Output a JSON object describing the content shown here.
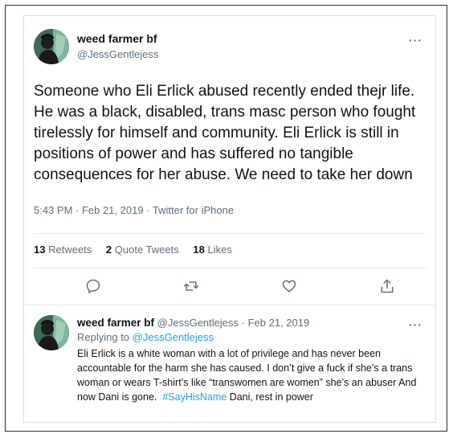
{
  "tweet": {
    "author_name": "weed farmer bf",
    "author_handle": "@JessGentlejess",
    "more_label": "···",
    "text": "Someone who Eli Erlick abused recently ended thejr life. He was a black, disabled, trans masc person who fought tirelessly for himself and community. Eli Erlick is still in positions of power and has suffered no tangible consequences for her abuse. We need to take her down",
    "timestamp": "5:43 PM · Feb 21, 2019 · Twitter for iPhone",
    "stats": {
      "retweets_count": "13",
      "retweets_label": "Retweets",
      "quotes_count": "2",
      "quotes_label": "Quote Tweets",
      "likes_count": "18",
      "likes_label": "Likes"
    },
    "actions": [
      {
        "icon": "reply-icon"
      },
      {
        "icon": "retweet-icon"
      },
      {
        "icon": "like-icon"
      },
      {
        "icon": "share-icon"
      }
    ]
  },
  "reply": {
    "author_name": "weed farmer bf",
    "author_handle": "@JessGentlejess",
    "separator": "·",
    "date": "Feb 21, 2019",
    "more_label": "···",
    "replying_prefix": "Replying to",
    "replying_to": "@JessGentlejess",
    "text_before_hashtag": "Eli Erlick is a white woman with a lot of privilege and has never been accountable for the harm she has caused. I don’t give a fuck if she’s a trans woman or wears T-shirt’s like “transwomen are women” she’s an abuser And now Dani is gone.",
    "hashtag": "#SayHisName",
    "text_after_hashtag": "Dani, rest in power"
  },
  "colors": {
    "accent": "#1da1f2",
    "secondary_text": "#5b7083",
    "primary_text": "#0f1419"
  }
}
